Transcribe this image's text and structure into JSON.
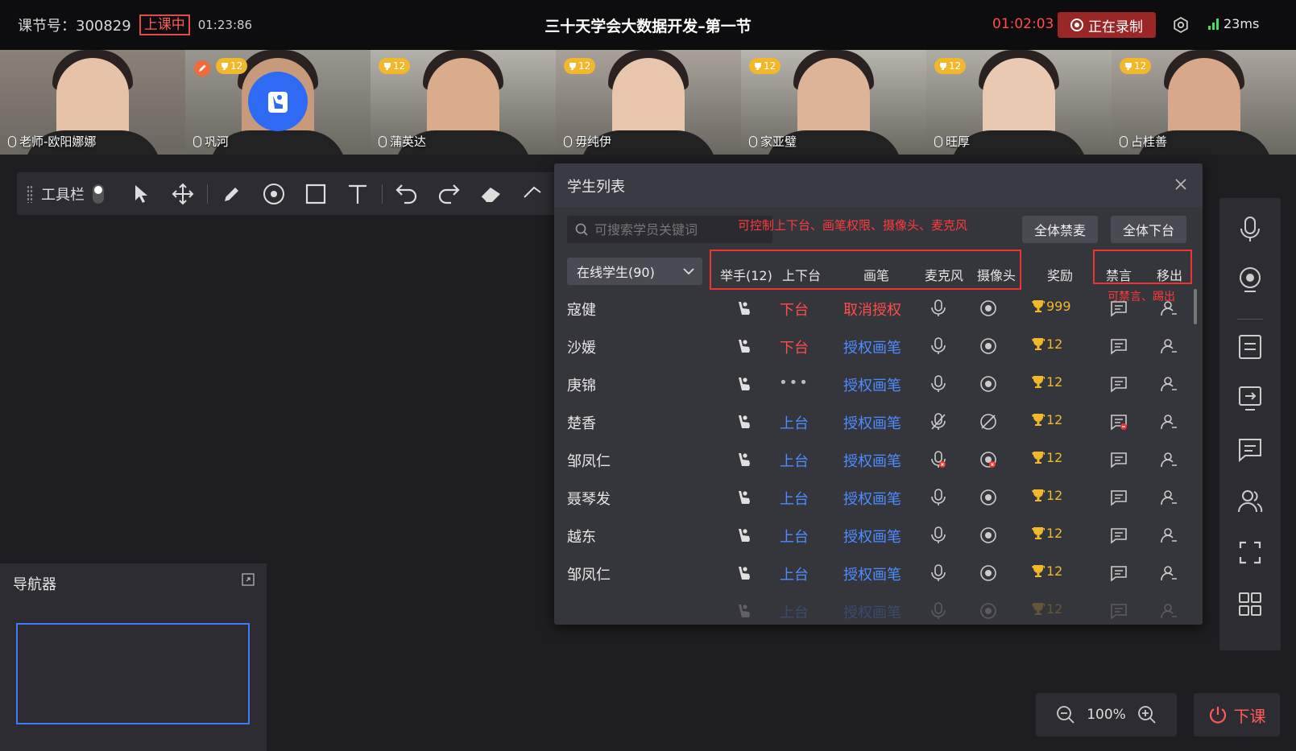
{
  "topbar": {
    "lesson_label": "课节号：300829",
    "live_badge": "上课中",
    "elapsed": "01:23:86",
    "course_title": "三十天学会大数据开发–第一节",
    "record_time": "01:02:03",
    "record_label": "正在录制",
    "latency": "23ms"
  },
  "videos": [
    {
      "name": "老师-欧阳娜娜",
      "badge": "",
      "skin": "#e6c2a8",
      "bg": "#8a8278"
    },
    {
      "name": "巩河",
      "badge": "12",
      "skin": "#c79a7c",
      "bg": "#9a9690",
      "pen": true,
      "raised": true
    },
    {
      "name": "蒲英达",
      "badge": "12",
      "skin": "#d9ac8c",
      "bg": "#b5b2ac"
    },
    {
      "name": "毋纯伊",
      "badge": "12",
      "skin": "#e8c5ad",
      "bg": "#a8a29a"
    },
    {
      "name": "家亚璧",
      "badge": "12",
      "skin": "#ddb498",
      "bg": "#b8b4ae"
    },
    {
      "name": "旺厚",
      "badge": "12",
      "skin": "#e9c9b2",
      "bg": "#b0aca6"
    },
    {
      "name": "占桂善",
      "badge": "12",
      "skin": "#d7a98a",
      "bg": "#a9a59e"
    }
  ],
  "toolbar": {
    "label": "工具栏"
  },
  "navigator": {
    "title": "导航器"
  },
  "panel": {
    "title": "学生列表",
    "search_placeholder": "可搜索学员关键词",
    "annotation_top": "可控制上下台、画笔权限、摄像头、麦克风",
    "annotation_right": "可禁言、踢出",
    "mute_all": "全体禁麦",
    "all_off_stage": "全体下台",
    "filter": "在线学生(90)",
    "columns": {
      "hand": "举手(12)",
      "stage": "上下台",
      "pen": "画笔",
      "mic": "麦克风",
      "camera": "摄像头",
      "reward": "奖励",
      "mute": "禁言",
      "kick": "移出"
    },
    "rows": [
      {
        "name": "寇健",
        "stage": "下台",
        "stage_color": "red",
        "pen": "取消授权",
        "pen_color": "red",
        "mic": "on",
        "cam": "on",
        "reward": "999",
        "chat": "on"
      },
      {
        "name": "沙媛",
        "stage": "下台",
        "stage_color": "red",
        "pen": "授权画笔",
        "pen_color": "blue",
        "mic": "on",
        "cam": "on",
        "reward": "12",
        "chat": "on"
      },
      {
        "name": "庚锦",
        "stage": "•••",
        "stage_color": "gray",
        "pen": "授权画笔",
        "pen_color": "blue",
        "mic": "on",
        "cam": "on",
        "reward": "12",
        "chat": "on"
      },
      {
        "name": "楚香",
        "stage": "上台",
        "stage_color": "blue",
        "pen": "授权画笔",
        "pen_color": "blue",
        "mic": "off",
        "cam": "off",
        "reward": "12",
        "chat": "muted"
      },
      {
        "name": "邹凤仁",
        "stage": "上台",
        "stage_color": "blue",
        "pen": "授权画笔",
        "pen_color": "blue",
        "mic": "error",
        "cam": "error",
        "reward": "12",
        "chat": "on"
      },
      {
        "name": "聂琴发",
        "stage": "上台",
        "stage_color": "blue",
        "pen": "授权画笔",
        "pen_color": "blue",
        "mic": "on",
        "cam": "on",
        "reward": "12",
        "chat": "on"
      },
      {
        "name": "越东",
        "stage": "上台",
        "stage_color": "blue",
        "pen": "授权画笔",
        "pen_color": "blue",
        "mic": "on",
        "cam": "on",
        "reward": "12",
        "chat": "on"
      },
      {
        "name": "邹凤仁",
        "stage": "上台",
        "stage_color": "blue",
        "pen": "授权画笔",
        "pen_color": "blue",
        "mic": "on",
        "cam": "on",
        "reward": "12",
        "chat": "on"
      },
      {
        "name": "",
        "stage": "上台",
        "stage_color": "blue",
        "pen": "授权画笔",
        "pen_color": "blue",
        "mic": "on",
        "cam": "on",
        "reward": "12",
        "chat": "on",
        "faded": true
      }
    ]
  },
  "zoom": {
    "level": "100%"
  },
  "end_class": {
    "label": "下课"
  },
  "colors": {
    "accent": "#3d7cf5",
    "danger": "#ff4d4d",
    "reward": "#f0b82a",
    "panel": "#35353c"
  }
}
